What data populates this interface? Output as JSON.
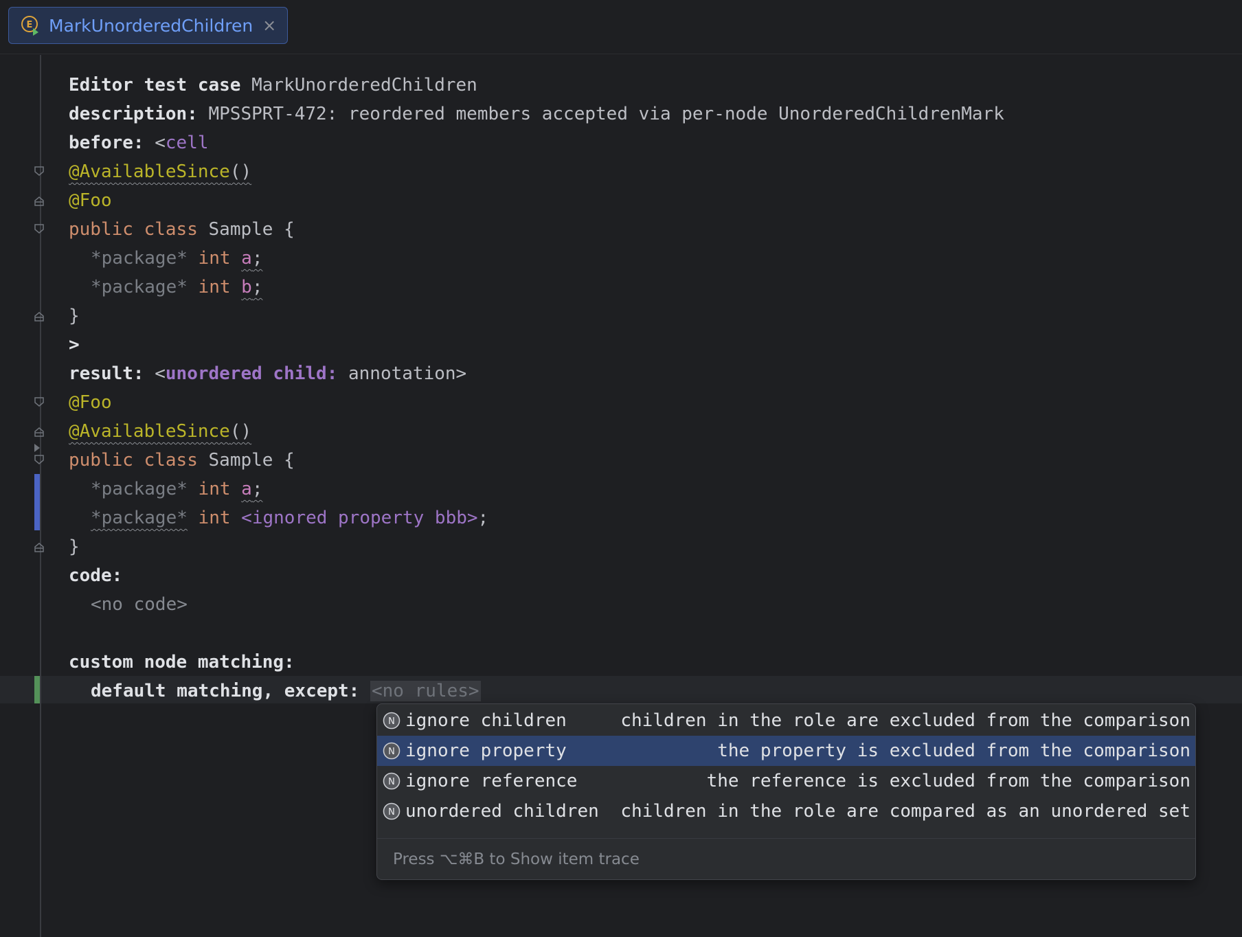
{
  "tab": {
    "label": "MarkUnorderedChildren",
    "close": "×"
  },
  "code": {
    "l1_kw": "Editor test case ",
    "l1_name": "MarkUnorderedChildren",
    "l2_kw": "description: ",
    "l2_text": "MPSSPRT-472: reordered members accepted via per-node UnorderedChildrenMark",
    "l3_kw": "before: ",
    "l3_lt": "<",
    "l3_cell": "cell",
    "ann_available": "@AvailableSince",
    "parens": "()",
    "ann_foo": "@Foo",
    "public": "public",
    "class": "class",
    "class_name": " Sample {",
    "package": "*package*",
    "int": "int",
    "field_a": "a",
    "field_b": "b",
    "semicolon": ";",
    "close_brace": "}",
    "gt": ">",
    "result_kw": "result: ",
    "result_lt": "<",
    "result_cell": "unordered child: ",
    "result_annotation": "annotation>",
    "ignored_prop": "<ignored property bbb>",
    "code_kw": "code:",
    "no_code": "<no code>",
    "custom_kw": "custom node matching:",
    "default_kw": "default matching, except: ",
    "no_rules": "<no rules>"
  },
  "completion": {
    "items": [
      {
        "name": "ignore children",
        "desc": "children in the role are excluded from the comparison",
        "icon": "node-icon"
      },
      {
        "name": "ignore property",
        "desc": "the property is excluded from the comparison",
        "icon": "node-icon"
      },
      {
        "name": "ignore reference",
        "desc": "the reference is excluded from the comparison",
        "icon": "node-icon"
      },
      {
        "name": "unordered children",
        "desc": "children in the role are compared as an unordered set",
        "icon": "node-icon"
      }
    ],
    "selected_index": 1,
    "footer": "Press ⌥⌘B to Show item trace"
  },
  "colors": {
    "background": "#1e1f22",
    "selection": "#2e436e",
    "annotation": "#bbb529",
    "keyword": "#cf8e6d",
    "field": "#c77dbb",
    "cell": "#9e75c7"
  }
}
